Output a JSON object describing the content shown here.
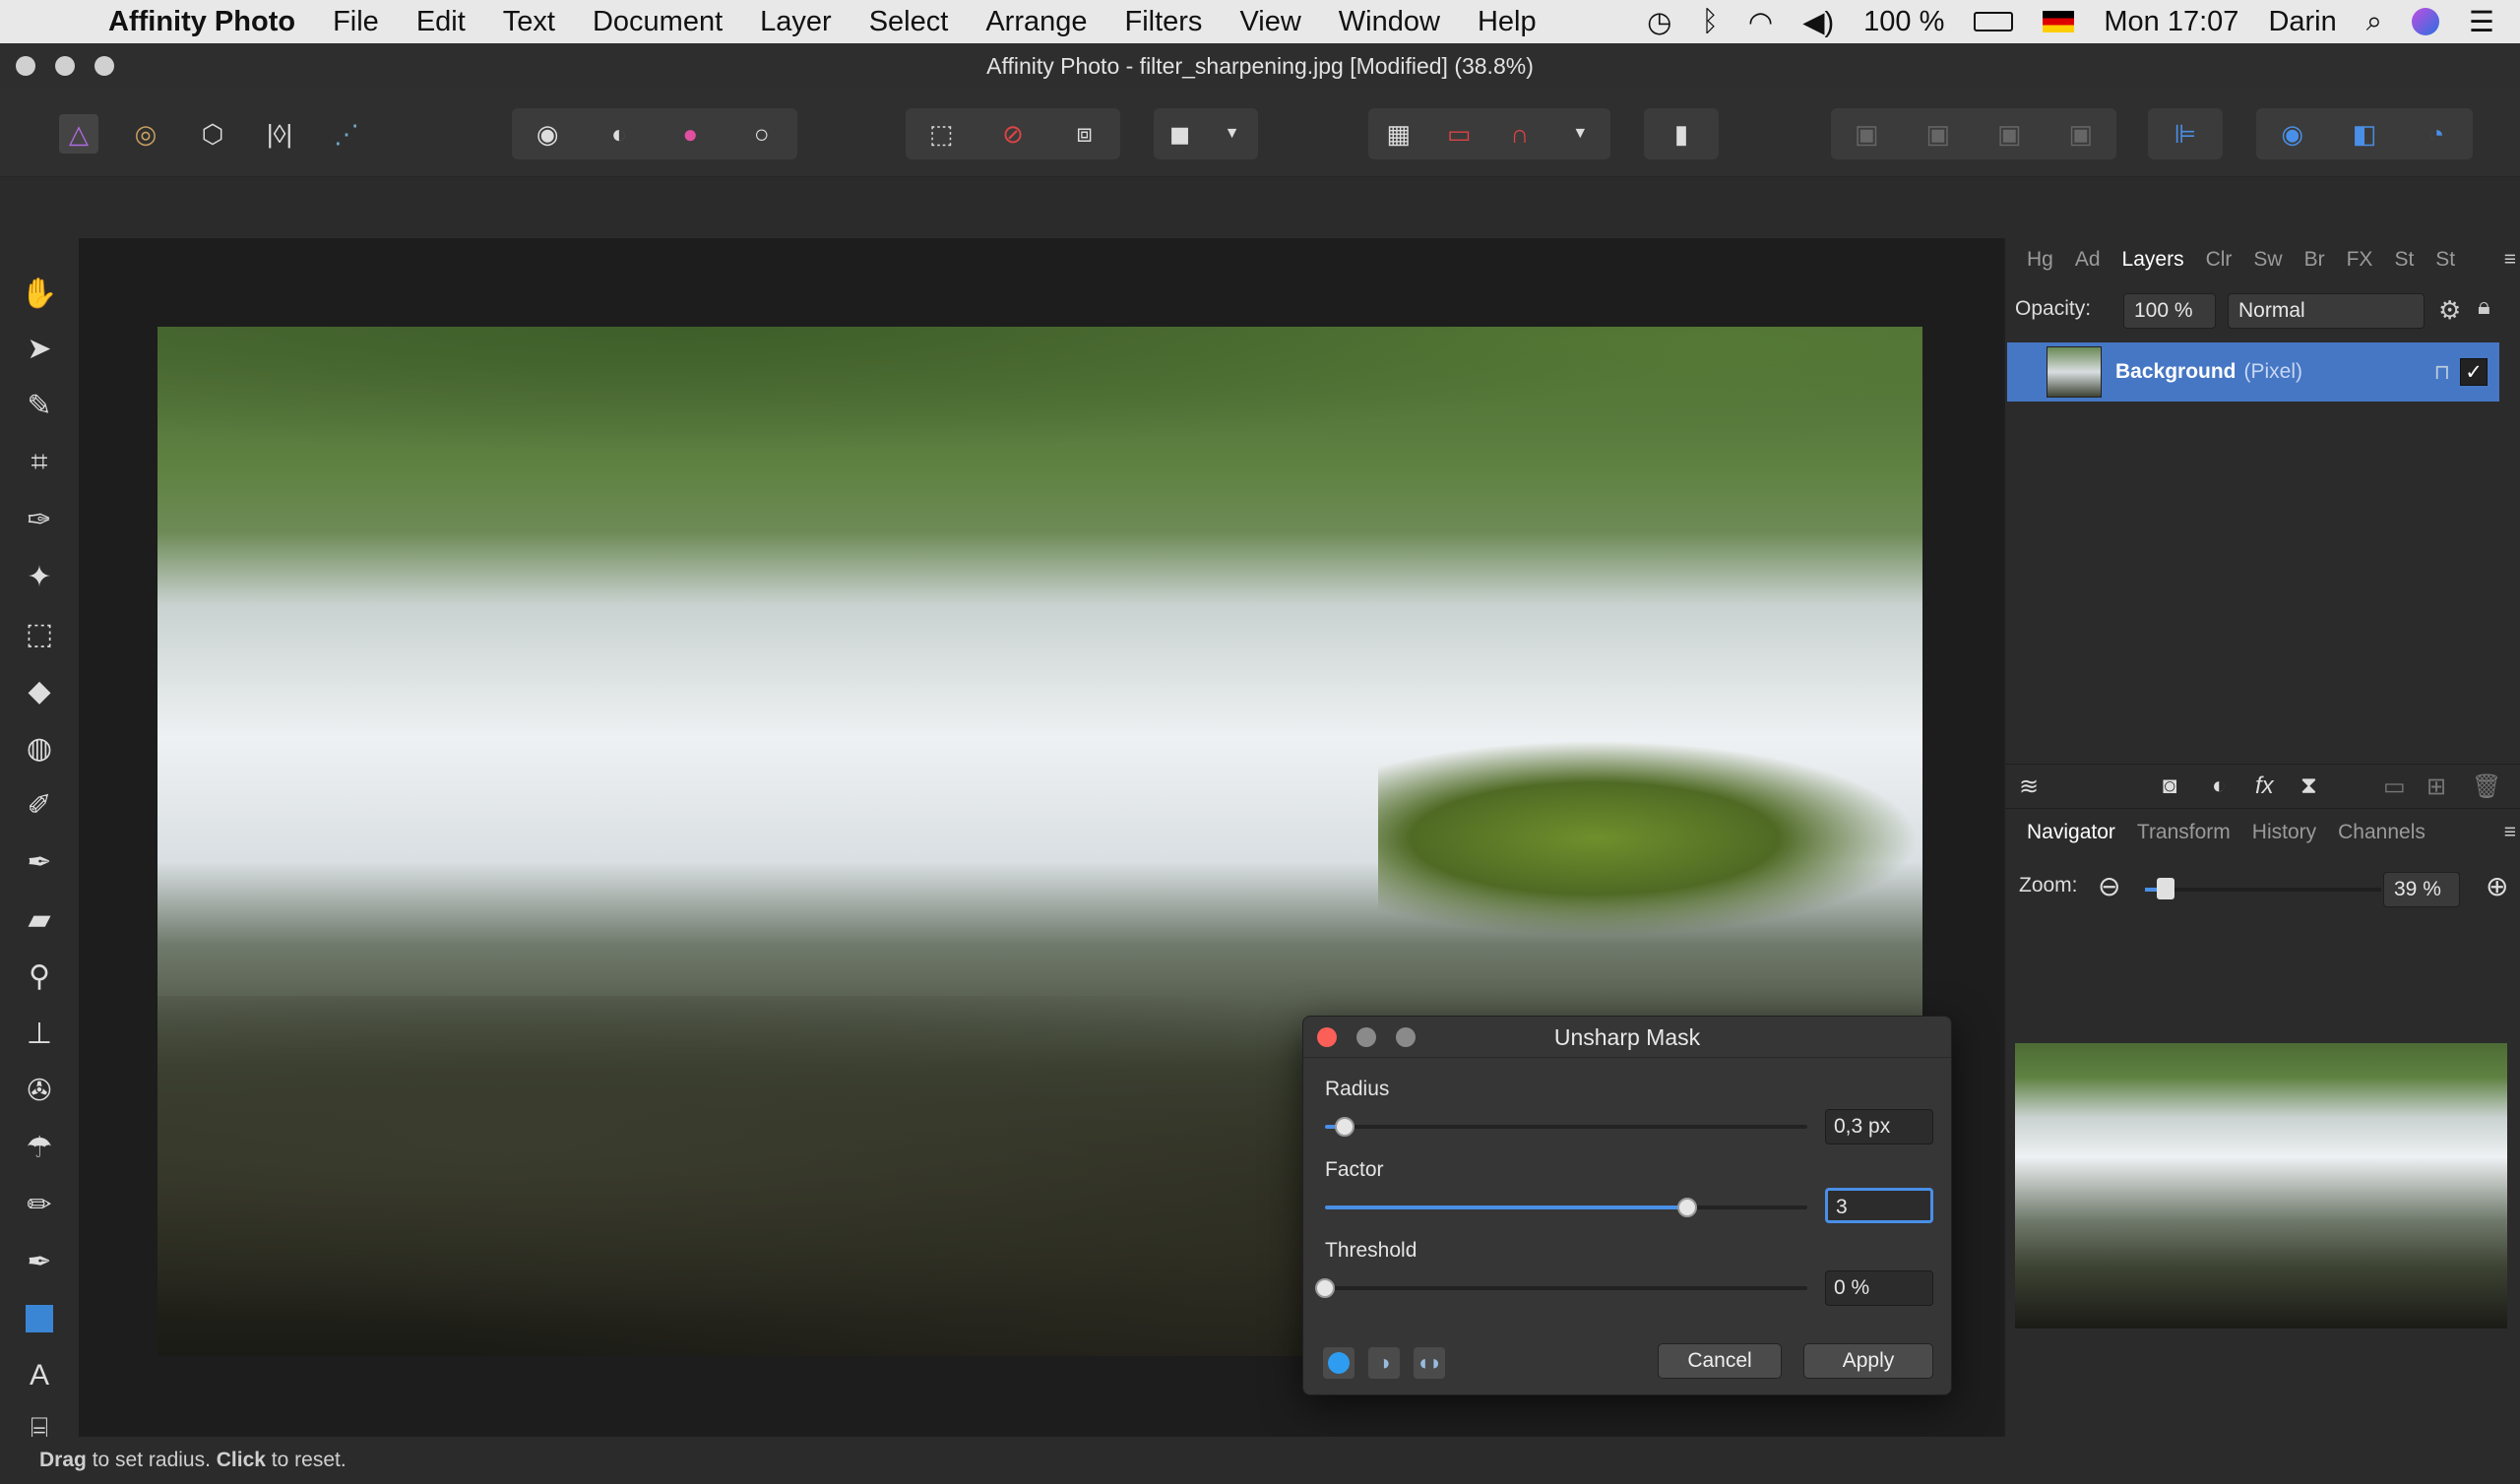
{
  "menubar": {
    "app_name": "Affinity Photo",
    "items": [
      "File",
      "Edit",
      "Text",
      "Document",
      "Layer",
      "Select",
      "Arrange",
      "Filters",
      "View",
      "Window",
      "Help"
    ],
    "battery": "100 %",
    "clock": "Mon 17:07",
    "user": "Darin"
  },
  "window": {
    "title": "Affinity Photo - filter_sharpening.jpg [Modified] (38.8%)"
  },
  "layers_panel": {
    "tabs": [
      "Hg",
      "Ad",
      "Layers",
      "Clr",
      "Sw",
      "Br",
      "FX",
      "St",
      "St"
    ],
    "active_tab": "Layers",
    "opacity_label": "Opacity:",
    "opacity_value": "100 %",
    "blend_mode": "Normal",
    "layer_name": "Background",
    "layer_type": "(Pixel)"
  },
  "navigator_panel": {
    "tabs": [
      "Navigator",
      "Transform",
      "History",
      "Channels"
    ],
    "active_tab": "Navigator",
    "zoom_label": "Zoom:",
    "zoom_value": "39 %",
    "zoom_level": 0.39
  },
  "dialog": {
    "title": "Unsharp Mask",
    "radius_label": "Radius",
    "radius_value": "0,3 px",
    "radius_fraction": 0.04,
    "factor_label": "Factor",
    "factor_value": "3",
    "factor_fraction": 0.75,
    "threshold_label": "Threshold",
    "threshold_value": "0 %",
    "threshold_fraction": 0.0,
    "cancel_label": "Cancel",
    "apply_label": "Apply"
  },
  "status": {
    "drag": "Drag",
    "drag_text": " to set radius. ",
    "click": "Click",
    "click_text": " to reset."
  },
  "colors": {
    "accent": "#4a8fe7",
    "selection": "#4677c4"
  }
}
